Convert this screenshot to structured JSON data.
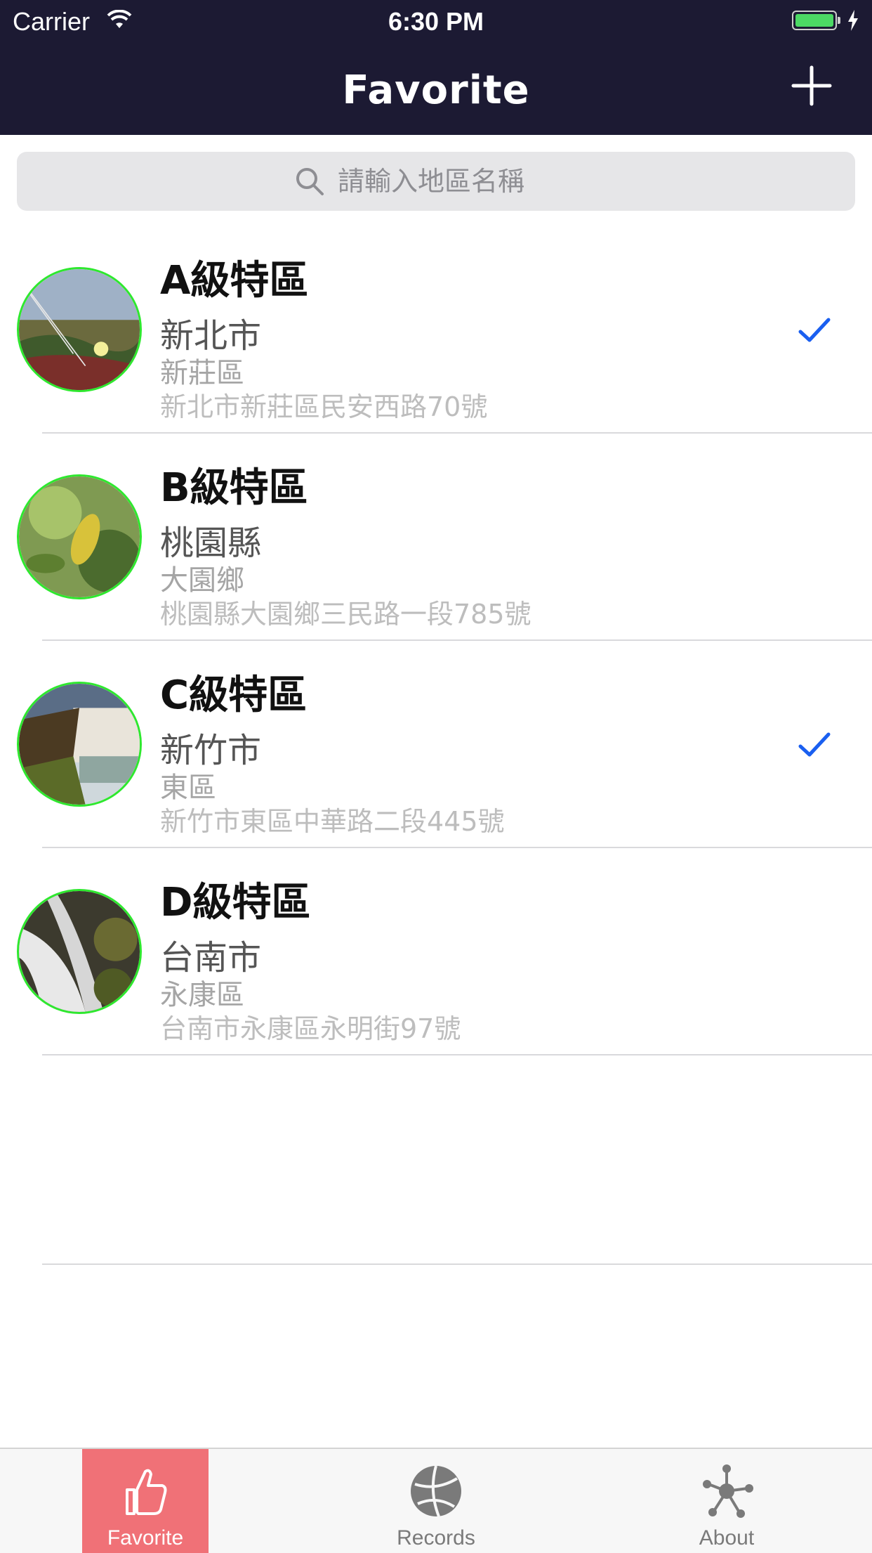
{
  "status_bar": {
    "carrier": "Carrier",
    "time": "6:30 PM"
  },
  "nav_bar": {
    "title": "Favorite",
    "add_icon": "plus-icon"
  },
  "search": {
    "placeholder": "請輸入地區名稱"
  },
  "items": [
    {
      "title": "A級特區",
      "city": "新北市",
      "district": "新莊區",
      "address": "新北市新莊區民安西路70號",
      "checked": true
    },
    {
      "title": "B級特區",
      "city": "桃園縣",
      "district": "大園鄉",
      "address": "桃園縣大園鄉三民路一段785號",
      "checked": false
    },
    {
      "title": "C級特區",
      "city": "新竹市",
      "district": "東區",
      "address": "新竹市東區中華路二段445號",
      "checked": true
    },
    {
      "title": "D級特區",
      "city": "台南市",
      "district": "永康區",
      "address": "台南市永康區永明街97號",
      "checked": false
    }
  ],
  "tab_bar": {
    "tabs": [
      {
        "label": "Favorite",
        "icon": "thumbs-up-icon",
        "active": true
      },
      {
        "label": "Records",
        "icon": "ball-icon",
        "active": false
      },
      {
        "label": "About",
        "icon": "network-icon",
        "active": false
      }
    ]
  },
  "colors": {
    "nav_background": "#1c1a33",
    "accent_tab": "#f07177",
    "check": "#1a5ff0",
    "avatar_border": "#2ee82e",
    "battery": "#4cd964"
  }
}
